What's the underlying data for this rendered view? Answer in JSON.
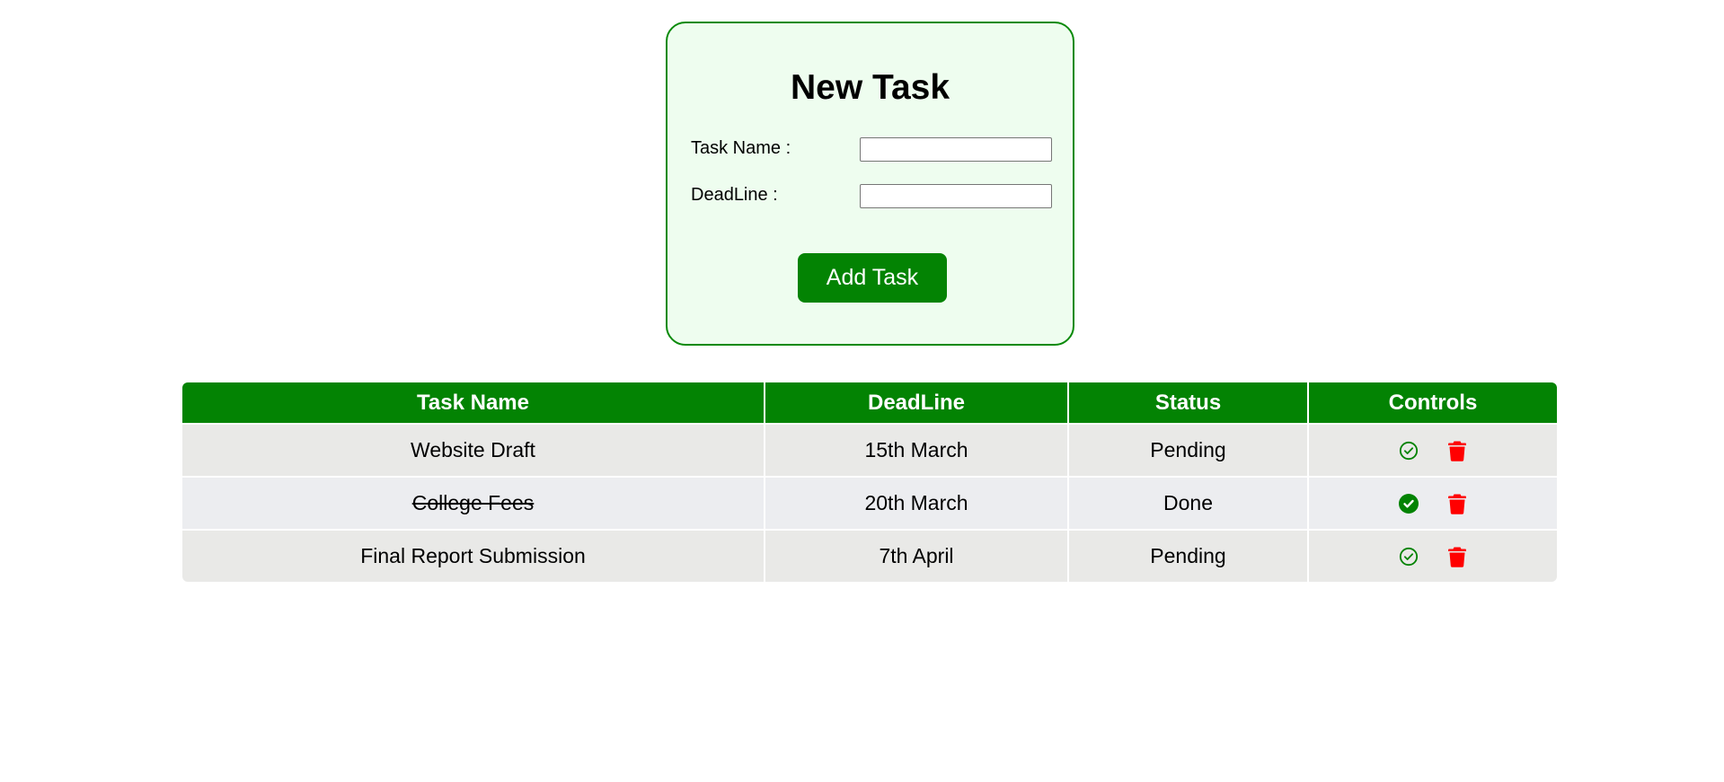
{
  "form": {
    "title": "New Task",
    "task_name_label": "Task Name :",
    "task_name_value": "",
    "deadline_label": "DeadLine :",
    "deadline_value": "",
    "add_button_label": "Add Task"
  },
  "table": {
    "headers": [
      "Task Name",
      "DeadLine",
      "Status",
      "Controls"
    ],
    "rows": [
      {
        "task": "Website Draft",
        "deadline": "15th March",
        "status": "Pending",
        "done": false
      },
      {
        "task": "College Fees",
        "deadline": "20th March",
        "status": "Done",
        "done": true
      },
      {
        "task": "Final Report Submission",
        "deadline": "7th April",
        "status": "Pending",
        "done": false
      }
    ]
  },
  "icons": {
    "mark_pending": "check-circle-outline-icon",
    "mark_done": "check-circle-filled-icon",
    "delete": "trash-icon"
  },
  "colors": {
    "accent": "#038303",
    "form_background": "#eefdef",
    "delete": "#ff0000",
    "row_odd": "#e9e9e7",
    "row_even": "#ecedf0"
  }
}
